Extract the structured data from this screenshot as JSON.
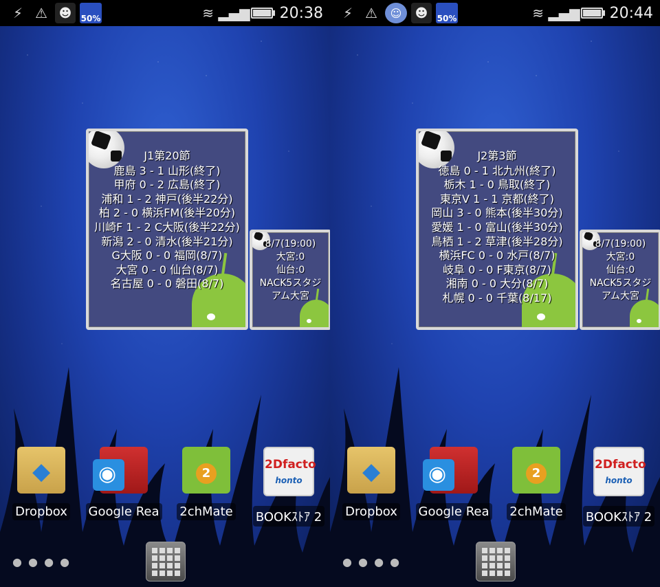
{
  "left": {
    "status": {
      "time": "20:38",
      "weather_percent": "50%"
    },
    "widget_big": {
      "title": "J1第20節",
      "lines": [
        "鹿島 3 - 1 山形(終了)",
        "甲府 0 - 2 広島(終了)",
        "浦和 1 - 2 神戸(後半22分)",
        "柏 2 - 0 横浜FM(後半20分)",
        "川崎F 1 - 2 C大阪(後半22分)",
        "新潟 2 - 0 清水(後半21分)",
        "G大阪 0 - 0 福岡(8/7)",
        "大宮 0 - 0 仙台(8/7)",
        "名古屋 0 - 0 磐田(8/7)"
      ]
    },
    "widget_small": {
      "lines": [
        "8/7(19:00)",
        "大宮:0",
        "仙台:0",
        "NACK5スタジ",
        "アム大宮"
      ]
    }
  },
  "right": {
    "status": {
      "time": "20:44",
      "weather_percent": "50%"
    },
    "widget_big": {
      "title": "J2第3節",
      "lines": [
        "徳島 0 - 1 北九州(終了)",
        "栃木 1 - 0 鳥取(終了)",
        "東京V 1 - 1 京都(終了)",
        "岡山 3 - 0 熊本(後半30分)",
        "愛媛 1 - 0 富山(後半30分)",
        "鳥栖 1 - 2 草津(後半28分)",
        "横浜FC 0 - 0 水戸(8/7)",
        "岐阜 0 - 0 F東京(8/7)",
        "湘南 0 - 0 大分(8/7)",
        "札幌 0 - 0 千葉(8/17)"
      ]
    },
    "widget_small": {
      "lines": [
        "8/7(19:00)",
        "大宮:0",
        "仙台:0",
        "NACK5スタジ",
        "アム大宮"
      ]
    }
  },
  "apps": {
    "dropbox": "Dropbox",
    "reader": "Google Rea",
    "mate": "2chMate",
    "book": "BOOKｽﾄｱ 2",
    "facto_logo": "2Dfacto",
    "facto_sub": "honto"
  },
  "colors": {
    "widget_bg": "#434a80",
    "wallpaper": "#1f43b0",
    "android_green": "#8cc63f"
  }
}
